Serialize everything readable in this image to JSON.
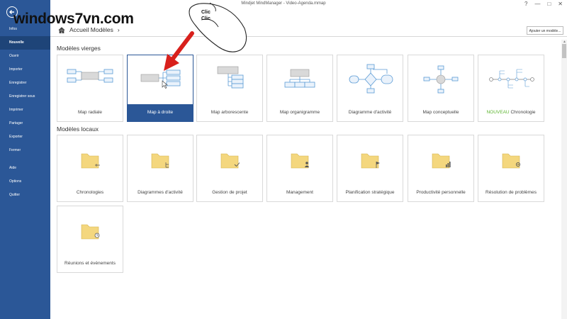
{
  "window": {
    "title": "Mindjet MindManager - Video-Agenda.mmap",
    "controls": [
      "?",
      "—",
      "□",
      "✕"
    ]
  },
  "watermark": "windows7vn.com",
  "annotation": {
    "clic1": "Clic",
    "clic2": "Clic"
  },
  "sidebar": {
    "items": [
      {
        "label": "Infos",
        "active": false
      },
      {
        "label": "Nouvelle",
        "active": true
      },
      {
        "label": "Ouvrir",
        "active": false
      },
      {
        "label": "Importer",
        "active": false
      },
      {
        "label": "Enregistrer",
        "active": false
      },
      {
        "label": "Enregistrer sous",
        "active": false
      },
      {
        "label": "Imprimer",
        "active": false
      },
      {
        "label": "Partager",
        "active": false
      },
      {
        "label": "Exporter",
        "active": false
      },
      {
        "label": "Fermer",
        "active": false
      },
      {
        "label": "Aide",
        "active": false
      },
      {
        "label": "Options",
        "active": false
      },
      {
        "label": "Quitter",
        "active": false
      }
    ]
  },
  "breadcrumb": {
    "label": "Accueil Modèles",
    "separator": "›"
  },
  "add_model_button": "Ajouter un modèle...",
  "sections": {
    "blank": {
      "title": "Modèles vierges",
      "items": [
        {
          "label": "Map radiale",
          "diagram": "radial"
        },
        {
          "label": "Map à droite",
          "diagram": "right",
          "selected": true
        },
        {
          "label": "Map arborescente",
          "diagram": "tree"
        },
        {
          "label": "Map organigramme",
          "diagram": "org"
        },
        {
          "label": "Diagramme d'activité",
          "diagram": "activity"
        },
        {
          "label": "Map conceptuelle",
          "diagram": "concept"
        },
        {
          "label": "Chronologie",
          "badge": "NOUVEAU",
          "diagram": "timeline"
        }
      ]
    },
    "local": {
      "title": "Modèles locaux",
      "items": [
        {
          "label": "Chronologies",
          "icon": "timeline-badge"
        },
        {
          "label": "Diagrammes d'activité",
          "icon": "flow-badge"
        },
        {
          "label": "Gestion de projet",
          "icon": "check-badge"
        },
        {
          "label": "Management",
          "icon": "person-badge"
        },
        {
          "label": "Planification stratégique",
          "icon": "flag-badge"
        },
        {
          "label": "Productivité personnelle",
          "icon": "chart-badge"
        },
        {
          "label": "Résolution de problèmes",
          "icon": "gear-badge"
        },
        {
          "label": "Réunions et événements",
          "icon": "clock-badge"
        }
      ]
    }
  },
  "colors": {
    "sidebar": "#2b5797",
    "sidebar_active": "#1e4478",
    "node_stroke": "#5b9bd5",
    "node_fill": "#eaf2fb",
    "central_fill": "#d9d9d9",
    "folder": "#f4d77e",
    "arrow": "#d8201c",
    "nouveau": "#5db530"
  }
}
